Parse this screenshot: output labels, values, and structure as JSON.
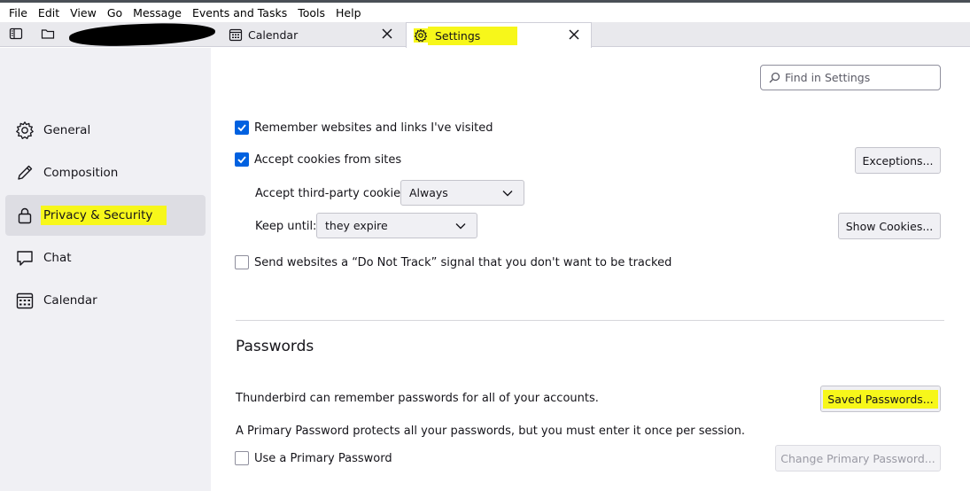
{
  "menubar": {
    "items": [
      "File",
      "Edit",
      "View",
      "Go",
      "Message",
      "Events and Tasks",
      "Tools",
      "Help"
    ]
  },
  "tabs": [
    {
      "label": "Calendar",
      "icon": "calendar-icon"
    },
    {
      "label": "Settings",
      "icon": "gear-icon"
    }
  ],
  "sidebar": {
    "items": [
      {
        "label": "General",
        "icon": "gear-icon"
      },
      {
        "label": "Composition",
        "icon": "pencil-icon"
      },
      {
        "label": "Privacy & Security",
        "icon": "lock-icon"
      },
      {
        "label": "Chat",
        "icon": "chat-icon"
      },
      {
        "label": "Calendar",
        "icon": "calendar-icon"
      }
    ]
  },
  "search": {
    "placeholder": "Find in Settings"
  },
  "privacy": {
    "remember_websites": "Remember websites and links I've visited",
    "accept_cookies": "Accept cookies from sites",
    "exceptions_button": "Exceptions...",
    "third_party_label": "Accept third-party cookies:",
    "third_party_value": "Always",
    "keep_until_label": "Keep until:",
    "keep_until_value": "they expire",
    "show_cookies_button": "Show Cookies...",
    "do_not_track": "Send websites a “Do Not Track” signal that you don't want to be tracked"
  },
  "passwords": {
    "title": "Passwords",
    "remember_text": "Thunderbird can remember passwords for all of your accounts.",
    "saved_passwords_button": "Saved Passwords...",
    "primary_text": "A Primary Password protects all your passwords, but you must enter it once per session.",
    "use_primary": "Use a Primary Password",
    "change_primary_button": "Change Primary Password..."
  },
  "colors": {
    "highlight": "#f7f71a",
    "checkbox": "#0061e0"
  }
}
